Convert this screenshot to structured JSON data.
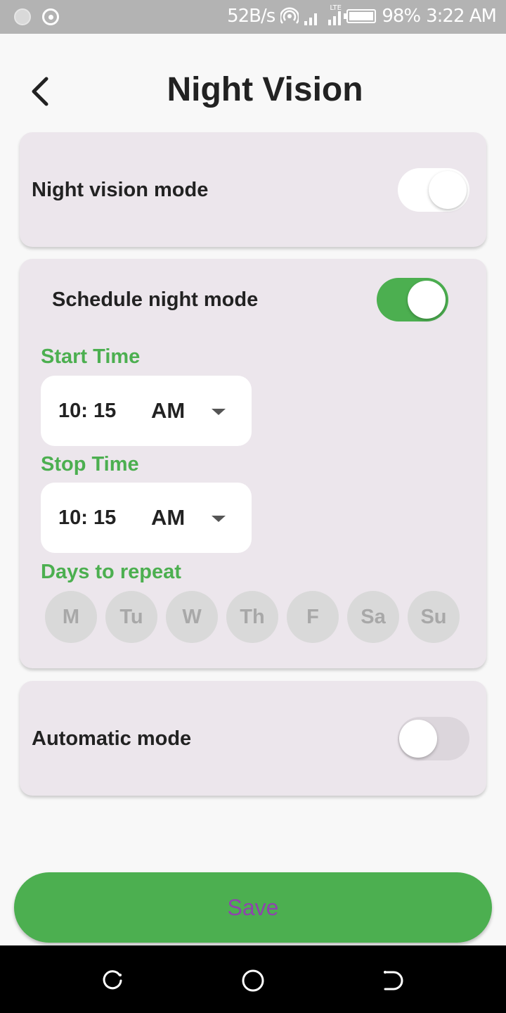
{
  "status_bar": {
    "speed": "52B/s",
    "battery": "98%",
    "time": "3:22 AM",
    "network": "LTE"
  },
  "header": {
    "title": "Night Vision"
  },
  "night_vision_card": {
    "label": "Night vision mode",
    "toggle_on": false
  },
  "schedule_card": {
    "label": "Schedule night mode",
    "toggle_on": true,
    "start_time_label": "Start Time",
    "start_time": "10: 15",
    "start_ampm": "AM",
    "stop_time_label": "Stop Time",
    "stop_time": "10: 15",
    "stop_ampm": "AM",
    "days_label": "Days to repeat",
    "days": [
      "M",
      "Tu",
      "W",
      "Th",
      "F",
      "Sa",
      "Su"
    ]
  },
  "automatic_card": {
    "label": "Automatic mode",
    "toggle_on": false
  },
  "save_label": "Save",
  "colors": {
    "accent_green": "#4caf50",
    "save_text": "#8e44ad",
    "card_bg": "#ece6ec"
  }
}
